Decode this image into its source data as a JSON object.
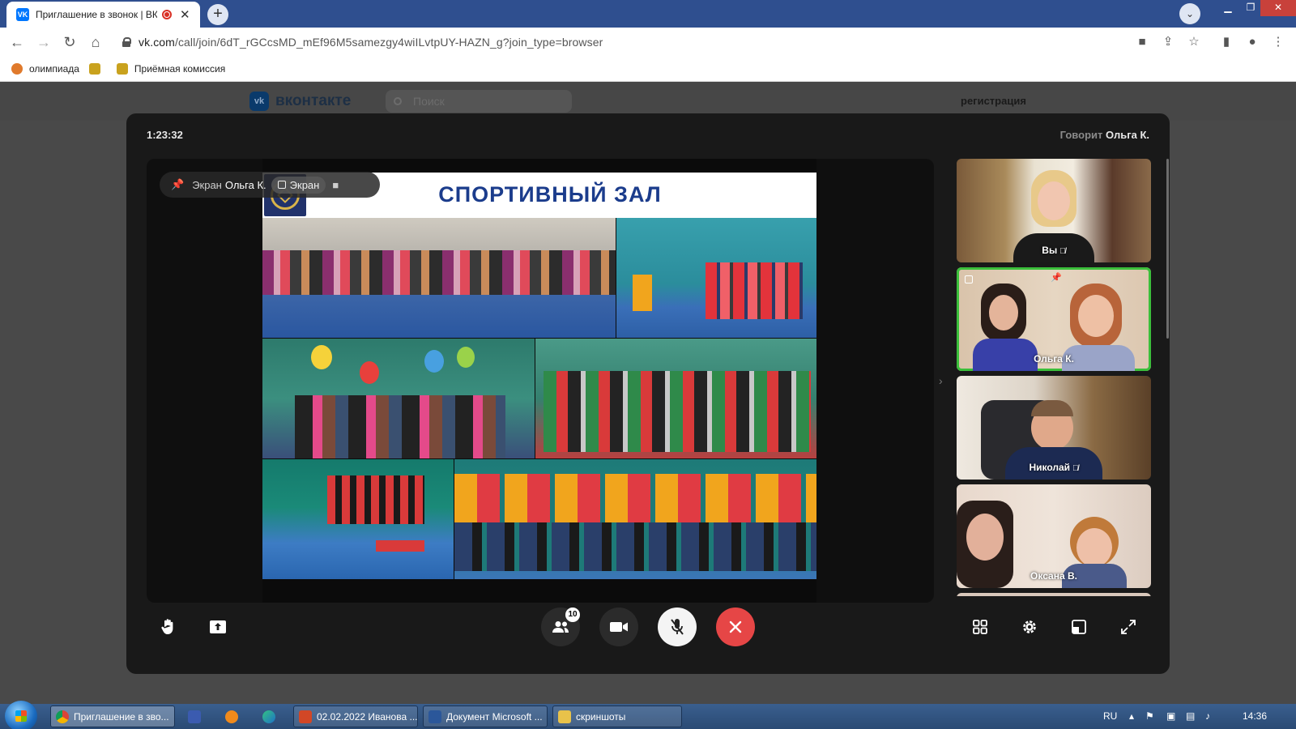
{
  "browser": {
    "tab_title": "Приглашение в звонок | ВК",
    "tab_close": "✕",
    "new_tab": "+",
    "url_main": "vk.com",
    "url_rest": "/call/join/6dT_rGCcsMD_mEf96M5samezgy4wiILvtpUY-HAZN_g?join_type=browser",
    "bookmarks": [
      "олимпиада",
      "Приёмная комиссия"
    ]
  },
  "vk": {
    "logo_text": "вконтакте",
    "logo_mark": "vk",
    "search_placeholder": "Поиск",
    "register": "регистрация"
  },
  "call": {
    "timer": "1:23:32",
    "speaking_label": "Говорит",
    "speaking_name": "Ольга К.",
    "pin_label": "Экран",
    "pin_name": "Ольга К.",
    "screen_chip": "Экран",
    "slide_title": "СПОРТИВНЫЙ ЗАЛ",
    "participants_badge": "10",
    "participants": [
      {
        "name": "Вы",
        "muted": true,
        "active": false
      },
      {
        "name": "Ольга К.",
        "muted": false,
        "active": true
      },
      {
        "name": "Николай",
        "muted": true,
        "active": false
      },
      {
        "name": "Оксана В.",
        "muted": false,
        "active": false
      }
    ],
    "mute_symbol": "🎤̸"
  },
  "taskbar": {
    "items": [
      {
        "label": "Приглашение в зво...",
        "icon": "chrome-icon",
        "active": true
      },
      {
        "label": "",
        "icon": "save-icon",
        "active": false
      },
      {
        "label": "",
        "icon": "media-player-icon",
        "active": false
      },
      {
        "label": "",
        "icon": "edge-icon",
        "active": false
      },
      {
        "label": "02.02.2022 Иванова ...",
        "icon": "powerpoint-icon",
        "active": false
      },
      {
        "label": "Документ Microsoft ...",
        "icon": "word-icon",
        "active": false
      },
      {
        "label": "скриншоты",
        "icon": "folder-icon",
        "active": false
      }
    ],
    "lang": "RU",
    "time": "14:36"
  },
  "colors": {
    "accent": "#0077ff",
    "active_speaker": "#3bbf3b",
    "end_call": "#e64646",
    "slide_title": "#1b3c8c"
  }
}
